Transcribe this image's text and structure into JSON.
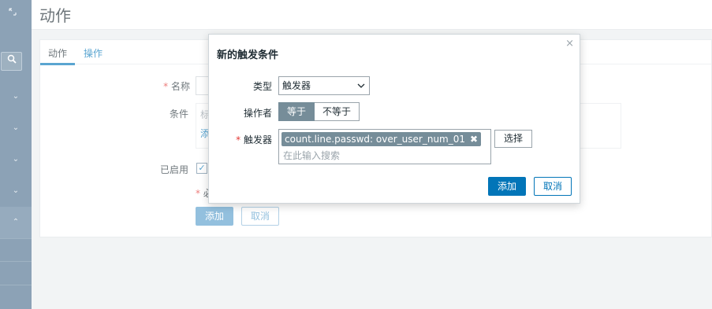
{
  "header": {
    "title": "动作"
  },
  "sidebar": {
    "collapse_icon": "collapse-icon",
    "search_icon": "search-icon",
    "items": [
      "chevron-down-icon",
      "chevron-down-icon",
      "chevron-down-icon",
      "chevron-down-icon",
      "chevron-up-icon"
    ]
  },
  "tabs": [
    {
      "label": "动作",
      "active": true
    },
    {
      "label": "操作",
      "active": false
    }
  ],
  "form": {
    "name_label": "名称",
    "conditions_label": "条件",
    "cond_placeholder_fragment": "标",
    "cond_add_fragment": "添",
    "enabled_label": "已启用",
    "required_note_fragment": "必",
    "add_button": "添加",
    "cancel_button": "取消"
  },
  "dialog": {
    "title": "新的触发条件",
    "close": "×",
    "type_label": "类型",
    "type_value": "触发器",
    "operator_label": "操作者",
    "operator_options": [
      "等于",
      "不等于"
    ],
    "operator_selected": "等于",
    "trigger_label": "触发器",
    "trigger_chip": "count.line.passwd: over_user_num_01",
    "trigger_chip_remove": "✖",
    "search_placeholder": "在此输入搜索",
    "select_button": "选择",
    "add_button": "添加",
    "cancel_button": "取消"
  },
  "colors": {
    "sidebar": "#4f7190",
    "accent": "#0275b8",
    "chip": "#768d99",
    "required": "#e33734"
  }
}
